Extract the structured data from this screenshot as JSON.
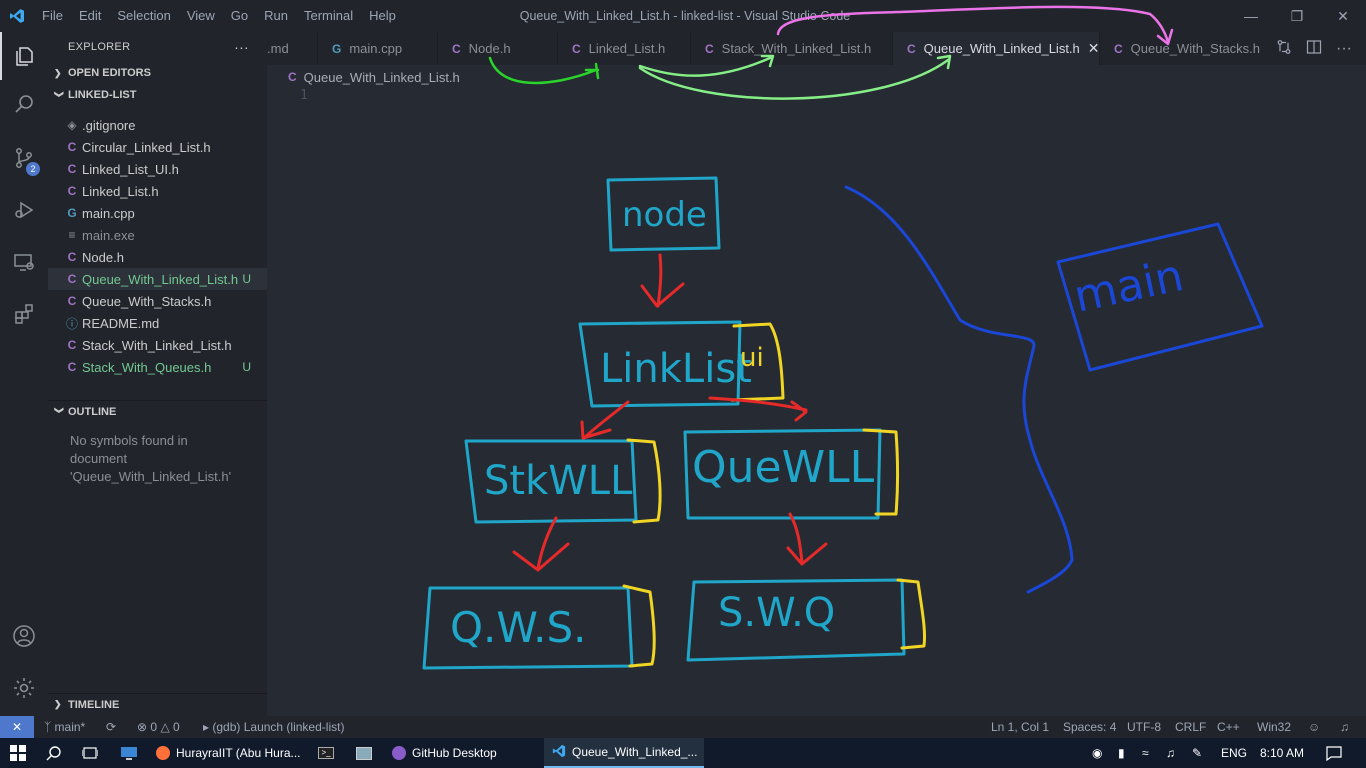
{
  "titlebar": {
    "menu": [
      "File",
      "Edit",
      "Selection",
      "View",
      "Go",
      "Run",
      "Terminal",
      "Help"
    ],
    "title": "Queue_With_Linked_List.h - linked-list - Visual Studio Code"
  },
  "activity": {
    "source_control_badge": "2"
  },
  "sidebar": {
    "title": "EXPLORER",
    "more": "···",
    "open_editors": "OPEN EDITORS",
    "folder": "LINKED-LIST",
    "files": [
      {
        "icon": "◈",
        "name": ".gitignore",
        "git": ""
      },
      {
        "icon": "C",
        "name": "Circular_Linked_List.h",
        "git": ""
      },
      {
        "icon": "C",
        "name": "Linked_List_UI.h",
        "git": ""
      },
      {
        "icon": "C",
        "name": "Linked_List.h",
        "git": ""
      },
      {
        "icon": "G",
        "name": "main.cpp",
        "git": ""
      },
      {
        "icon": "≡",
        "name": "main.exe",
        "git": ""
      },
      {
        "icon": "C",
        "name": "Node.h",
        "git": ""
      },
      {
        "icon": "C",
        "name": "Queue_With_Linked_List.h",
        "git": "U"
      },
      {
        "icon": "C",
        "name": "Queue_With_Stacks.h",
        "git": ""
      },
      {
        "icon": "ⓘ",
        "name": "README.md",
        "git": ""
      },
      {
        "icon": "C",
        "name": "Stack_With_Linked_List.h",
        "git": ""
      },
      {
        "icon": "C",
        "name": "Stack_With_Queues.h",
        "git": "U"
      }
    ],
    "outline": "OUTLINE",
    "outline_msg_1": "No symbols found in",
    "outline_msg_2": "document",
    "outline_msg_3": "'Queue_With_Linked_List.h'",
    "timeline": "TIMELINE"
  },
  "tabs": [
    {
      "icon": "",
      "label": ".md"
    },
    {
      "icon": "G",
      "label": "main.cpp"
    },
    {
      "icon": "C",
      "label": "Node.h"
    },
    {
      "icon": "C",
      "label": "Linked_List.h"
    },
    {
      "icon": "C",
      "label": "Stack_With_Linked_List.h"
    },
    {
      "icon": "C",
      "label": "Queue_With_Linked_List.h"
    },
    {
      "icon": "C",
      "label": "Queue_With_Stacks.h"
    }
  ],
  "editor": {
    "breadcrumb": "Queue_With_Linked_List.h",
    "line_number": "1"
  },
  "drawing": {
    "node": "node",
    "linklist": "LinkList",
    "ui": "ui",
    "stkwll": "StkWLL",
    "quewll": "QueWLL",
    "qws": "Q.W.S.",
    "swq": "S.W.Q",
    "main": "main"
  },
  "statusbar": {
    "branch": "main*",
    "errors": "0",
    "warnings": "0",
    "debug": "(gdb) Launch (linked-list)",
    "position": "Ln 1, Col 1",
    "spaces": "Spaces: 4",
    "encoding": "UTF-8",
    "eol": "CRLF",
    "language": "C++",
    "platform": "Win32"
  },
  "taskbar": {
    "firefox": "HurayraIIT (Abu Hura...",
    "github": "GitHub Desktop",
    "vscode": "Queue_With_Linked_...",
    "lang": "ENG",
    "time": "8:10 AM"
  }
}
